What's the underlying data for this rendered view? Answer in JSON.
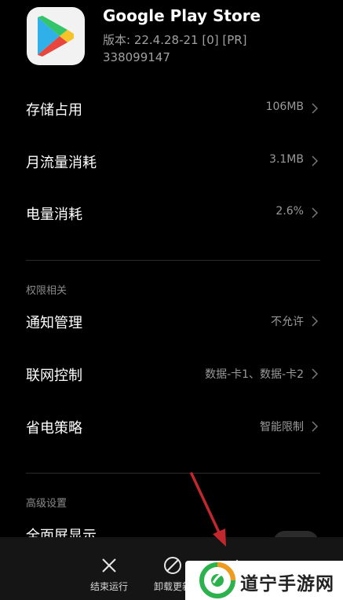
{
  "app": {
    "name": "Google Play Store",
    "version": "版本: 22.4.28-21 [0] [PR]",
    "build": "338099147"
  },
  "usage": [
    {
      "label": "存储占用",
      "value": "106MB"
    },
    {
      "label": "月流量消耗",
      "value": "3.1MB"
    },
    {
      "label": "电量消耗",
      "value": "2.6%"
    }
  ],
  "permissions": {
    "header": "权限相关",
    "items": [
      {
        "label": "通知管理",
        "value": "不允许"
      },
      {
        "label": "联网控制",
        "value": "数据-卡1、数据-卡2"
      },
      {
        "label": "省电策略",
        "value": "智能限制"
      }
    ]
  },
  "advanced": {
    "header": "高级设置",
    "partial_item": "全面屏显示"
  },
  "actions": {
    "stop": "结束运行",
    "uninstall": "卸载更新"
  },
  "watermark": {
    "text": "道宁手游网"
  },
  "colors": {
    "background": "#000000",
    "bottom_bar": "#151515",
    "annotation_arrow": "#c0282d"
  }
}
